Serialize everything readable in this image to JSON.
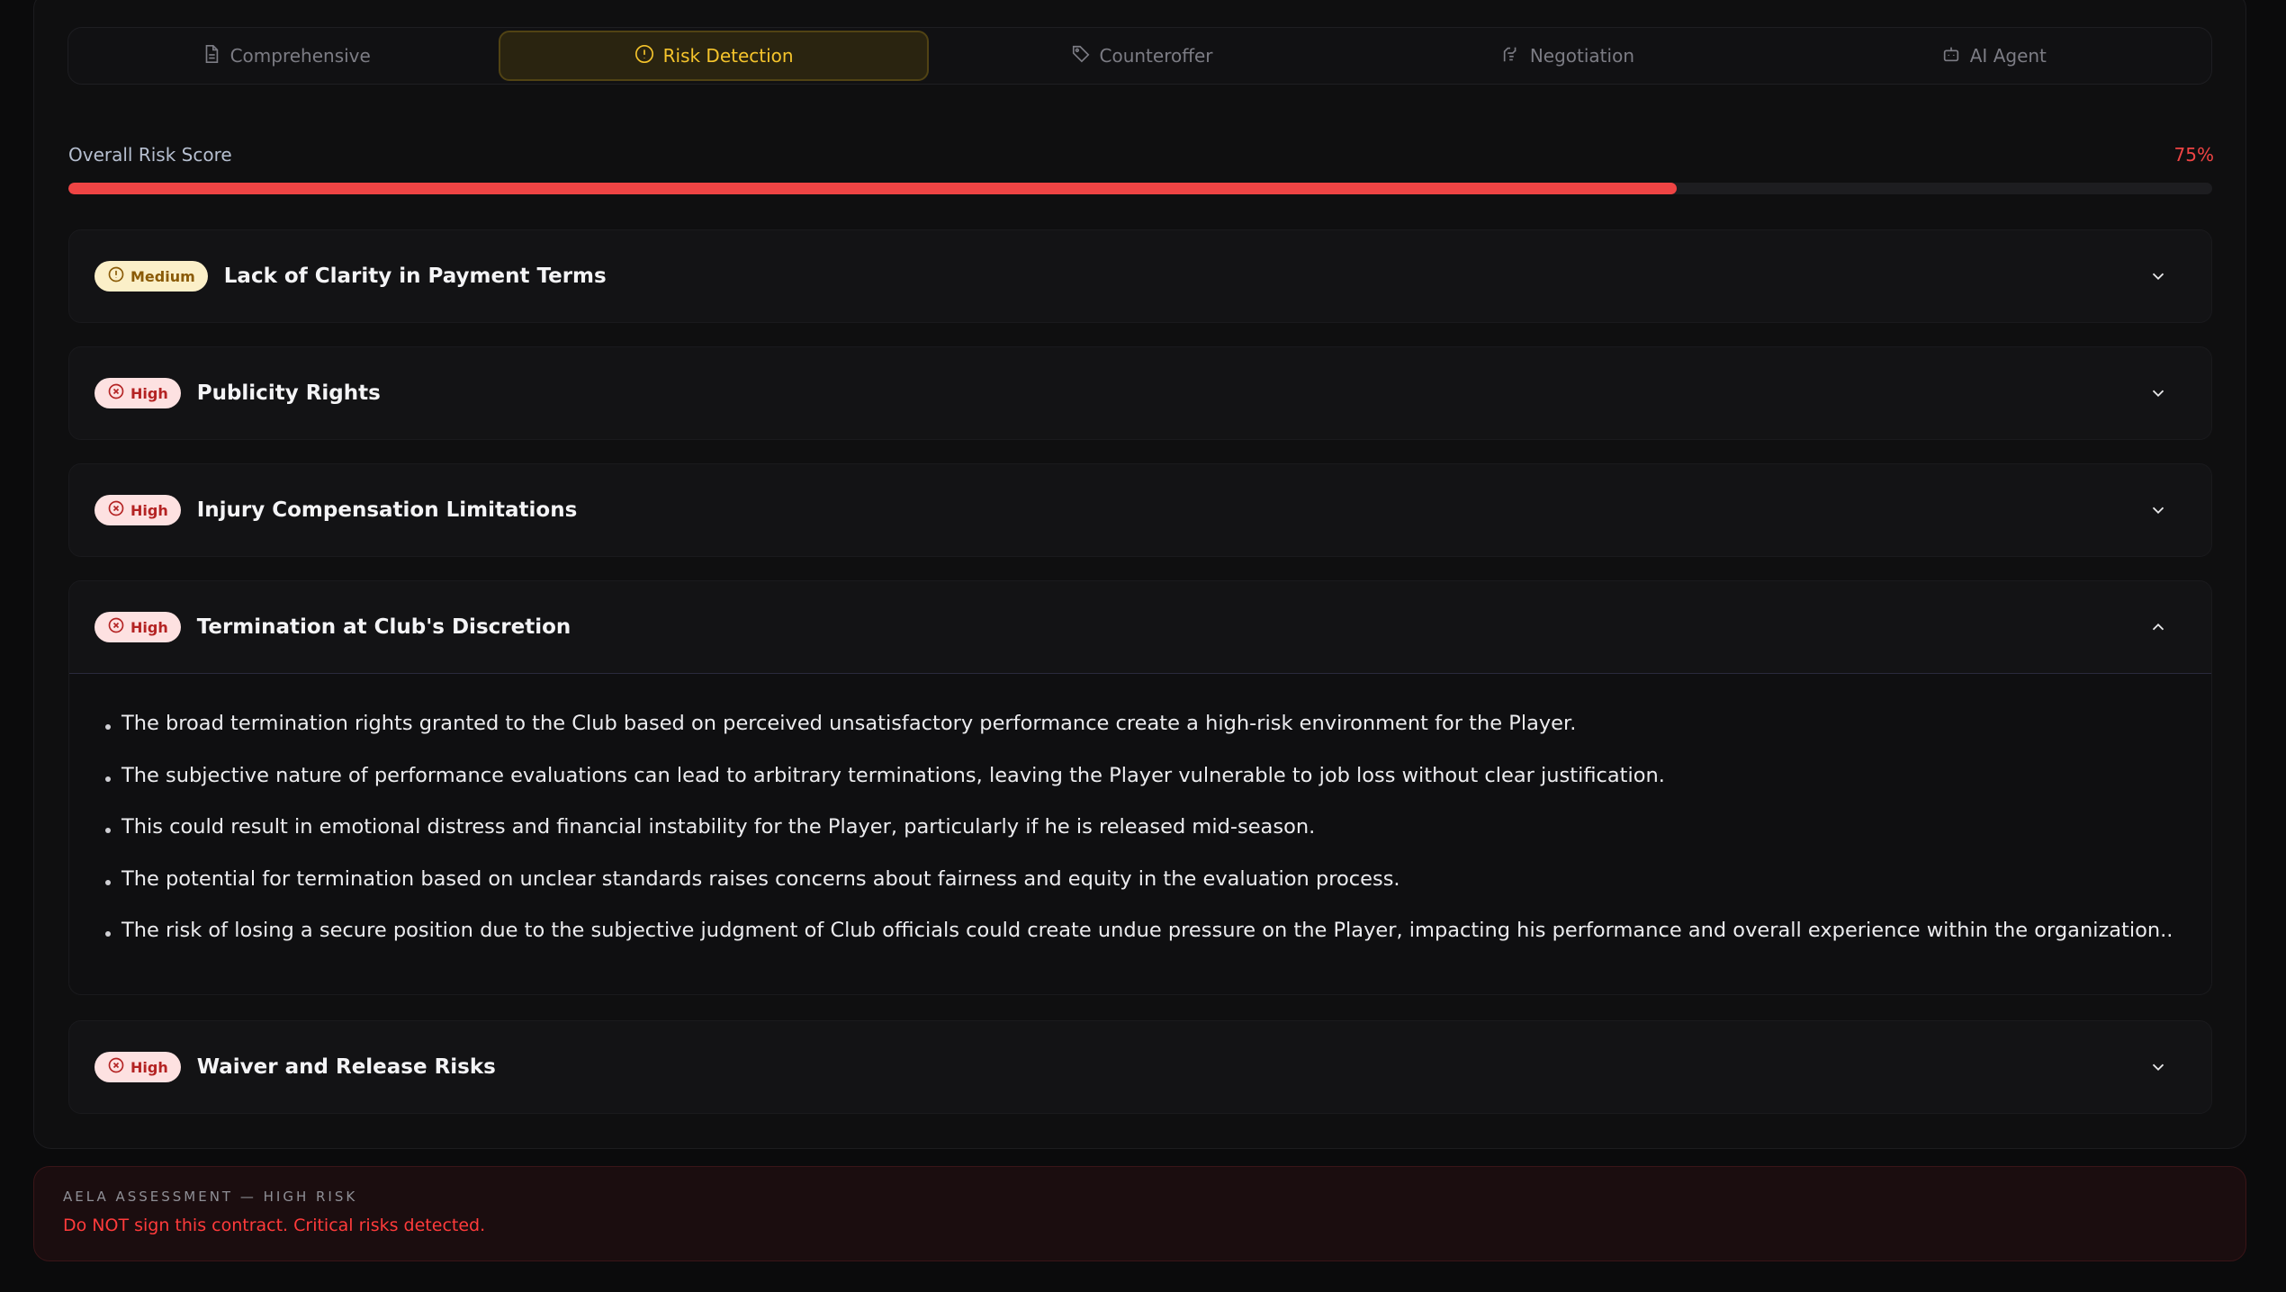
{
  "tabs": [
    {
      "label": "Comprehensive",
      "icon": "document-icon",
      "active": false
    },
    {
      "label": "Risk Detection",
      "icon": "alert-circle-icon",
      "active": true
    },
    {
      "label": "Counteroffer",
      "icon": "tag-icon",
      "active": false
    },
    {
      "label": "Negotiation",
      "icon": "handshake-icon",
      "active": false
    },
    {
      "label": "AI Agent",
      "icon": "bot-icon",
      "active": false
    }
  ],
  "score": {
    "label": "Overall Risk Score",
    "value_text": "75%",
    "fill_fraction": 0.75,
    "color": "#ef4444"
  },
  "risks": [
    {
      "level": "Medium",
      "title": "Lack of Clarity in Payment Terms",
      "expanded": false
    },
    {
      "level": "High",
      "title": "Publicity Rights",
      "expanded": false
    },
    {
      "level": "High",
      "title": "Injury Compensation Limitations",
      "expanded": false
    },
    {
      "level": "High",
      "title": "Termination at Club's Discretion",
      "expanded": true,
      "points": [
        "The broad termination rights granted to the Club based on perceived unsatisfactory performance create a high-risk environment for the Player.",
        "The subjective nature of performance evaluations can lead to arbitrary terminations, leaving the Player vulnerable to job loss without clear justification.",
        "This could result in emotional distress and financial instability for the Player, particularly if he is released mid-season.",
        "The potential for termination based on unclear standards raises concerns about fairness and equity in the evaluation process.",
        "The risk of losing a secure position due to the subjective judgment of Club officials could create undue pressure on the Player, impacting his performance and overall experience within the organization.."
      ]
    },
    {
      "level": "High",
      "title": "Waiver and Release Risks",
      "expanded": false
    }
  ],
  "assessment": {
    "label": "AELA ASSESSMENT — HIGH RISK",
    "message": "Do NOT sign this contract. Critical risks detected."
  },
  "colors": {
    "accent": "#f5c42c",
    "danger": "#ef4444",
    "badge_medium_bg": "#fbefc8",
    "badge_high_bg": "#fde1e1"
  }
}
